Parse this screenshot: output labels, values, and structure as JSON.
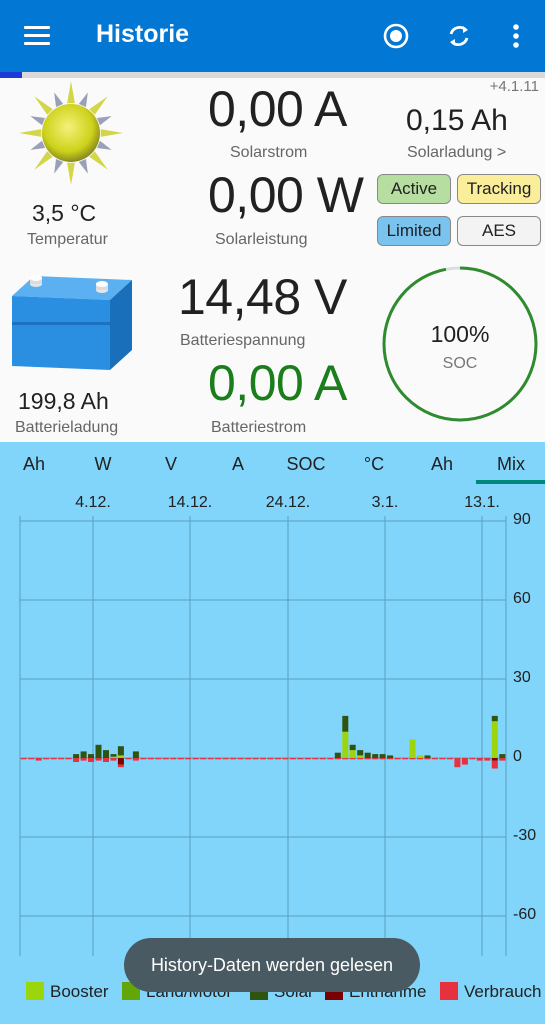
{
  "appbar": {
    "title": "Historie"
  },
  "version": "+4.1.11",
  "header_progress": 0.04,
  "temperature": {
    "value": "3,5 °C",
    "label": "Temperatur"
  },
  "solar_current": {
    "value": "0,00 A",
    "label": "Solarstrom"
  },
  "solar_power": {
    "value": "0,00 W",
    "label": "Solarleistung"
  },
  "solar_charge": {
    "value": "0,15 Ah",
    "label": "Solarladung >"
  },
  "status_chips": {
    "active": "Active",
    "tracking": "Tracking",
    "limited": "Limited",
    "aes": "AES"
  },
  "battery_charge": {
    "value": "199,8 Ah",
    "label": "Batterieladung"
  },
  "battery_voltage": {
    "value": "14,48 V",
    "label": "Batteriespannung"
  },
  "battery_current": {
    "value": "0,00 A",
    "label": "Batteriestrom"
  },
  "soc": {
    "value": "100%",
    "label": "SOC",
    "fraction": 1.0
  },
  "tabs": [
    "Ah",
    "W",
    "V",
    "A",
    "SOC",
    "°C",
    "Ah",
    "Mix"
  ],
  "selected_tab": "Mix",
  "toast": "History-Daten werden gelesen",
  "colors": {
    "appbar": "#0277d4",
    "Booster": "#9bd60c",
    "Land/Motor": "#63a60a",
    "Solar": "#2f5410",
    "Entnahme": "#7a0000",
    "Verbrauch": "#e8313e"
  },
  "chart_data": {
    "type": "bar",
    "x_ticks": [
      "4.12.",
      "14.12.",
      "24.12.",
      "3.1.",
      "13.1."
    ],
    "ylim": [
      -70,
      90
    ],
    "y_ticks": [
      90,
      60,
      30,
      0,
      -30,
      -60
    ],
    "grid": true,
    "legend": "bottom",
    "series": [
      {
        "name": "Booster",
        "values": [
          0,
          0,
          0,
          0,
          0,
          0,
          0,
          0,
          0,
          0,
          0,
          0,
          0.5,
          1,
          0,
          0,
          0,
          0,
          0,
          0,
          0,
          0,
          0,
          0,
          0,
          0,
          0,
          0,
          0,
          0,
          0,
          0,
          0,
          0,
          0,
          0,
          0,
          0,
          0,
          0,
          0,
          0,
          0,
          10,
          3,
          1,
          0,
          0,
          0,
          0,
          0,
          0,
          7,
          1,
          0,
          0,
          0,
          0,
          0,
          0,
          0,
          0,
          0,
          14,
          0
        ]
      },
      {
        "name": "Land/Motor",
        "values": [
          0,
          0,
          0,
          0,
          0,
          0,
          0,
          0,
          0,
          0,
          0,
          0,
          0,
          0,
          0,
          0,
          0,
          0,
          0,
          0,
          0,
          0,
          0,
          0,
          0,
          0,
          0,
          0,
          0,
          0,
          0,
          0,
          0,
          0,
          0,
          0,
          0,
          0,
          0,
          0,
          0,
          0,
          0,
          0,
          0,
          0,
          0,
          0,
          0,
          0,
          0,
          0,
          0,
          0,
          0,
          0,
          0,
          0,
          0,
          0,
          0,
          0,
          0,
          0,
          0
        ]
      },
      {
        "name": "Solar",
        "values": [
          0,
          0,
          0,
          0,
          0,
          0,
          0,
          1.5,
          2.5,
          1.5,
          5,
          3,
          1,
          3.5,
          0,
          2.5,
          0,
          0,
          0,
          0,
          0,
          0,
          0,
          0,
          0,
          0,
          0,
          0,
          0,
          0,
          0,
          0,
          0,
          0,
          0,
          0,
          0,
          0,
          0,
          0,
          0,
          0,
          2,
          6,
          2,
          2,
          2,
          1.5,
          1.5,
          1,
          0,
          0,
          0,
          0,
          1,
          0,
          0,
          0,
          0,
          0,
          0,
          0,
          0,
          2,
          1.5
        ]
      },
      {
        "name": "Entnahme",
        "values": [
          0,
          0,
          0,
          0,
          0,
          0,
          0,
          0,
          0,
          0,
          0,
          0,
          0,
          -2.5,
          0,
          0,
          0,
          0,
          0,
          0,
          0,
          0,
          0,
          0,
          0,
          0,
          0,
          0,
          0,
          0,
          0,
          0,
          0,
          0,
          0,
          0,
          0,
          0,
          0,
          0,
          0,
          0,
          0,
          0,
          0,
          0,
          0,
          0,
          0,
          0,
          0,
          0,
          0,
          0,
          0,
          0,
          0,
          0,
          0,
          0,
          0,
          0,
          0,
          -1,
          0
        ]
      },
      {
        "name": "Verbrauch",
        "values": [
          -0.5,
          -0.5,
          -1,
          -0.5,
          -0.5,
          -0.5,
          -0.5,
          -1.5,
          -1,
          -1.5,
          -1,
          -1.5,
          -1,
          -1,
          -0.5,
          -1,
          -0.5,
          -0.5,
          -0.5,
          -0.5,
          -0.5,
          -0.5,
          -0.5,
          -0.5,
          -0.5,
          -0.5,
          -0.5,
          -0.5,
          -0.5,
          -0.5,
          -0.5,
          -0.5,
          -0.5,
          -0.5,
          -0.5,
          -0.5,
          -0.5,
          -0.5,
          -0.5,
          -0.5,
          -0.5,
          -0.5,
          -0.5,
          -0.5,
          -0.5,
          -0.5,
          -0.5,
          -0.5,
          -0.5,
          -0.5,
          -0.5,
          -0.5,
          -0.5,
          -0.5,
          -0.5,
          -0.5,
          -0.5,
          -0.5,
          -3.5,
          -2.5,
          -0.5,
          -1,
          -1,
          -3,
          -1
        ]
      }
    ]
  }
}
